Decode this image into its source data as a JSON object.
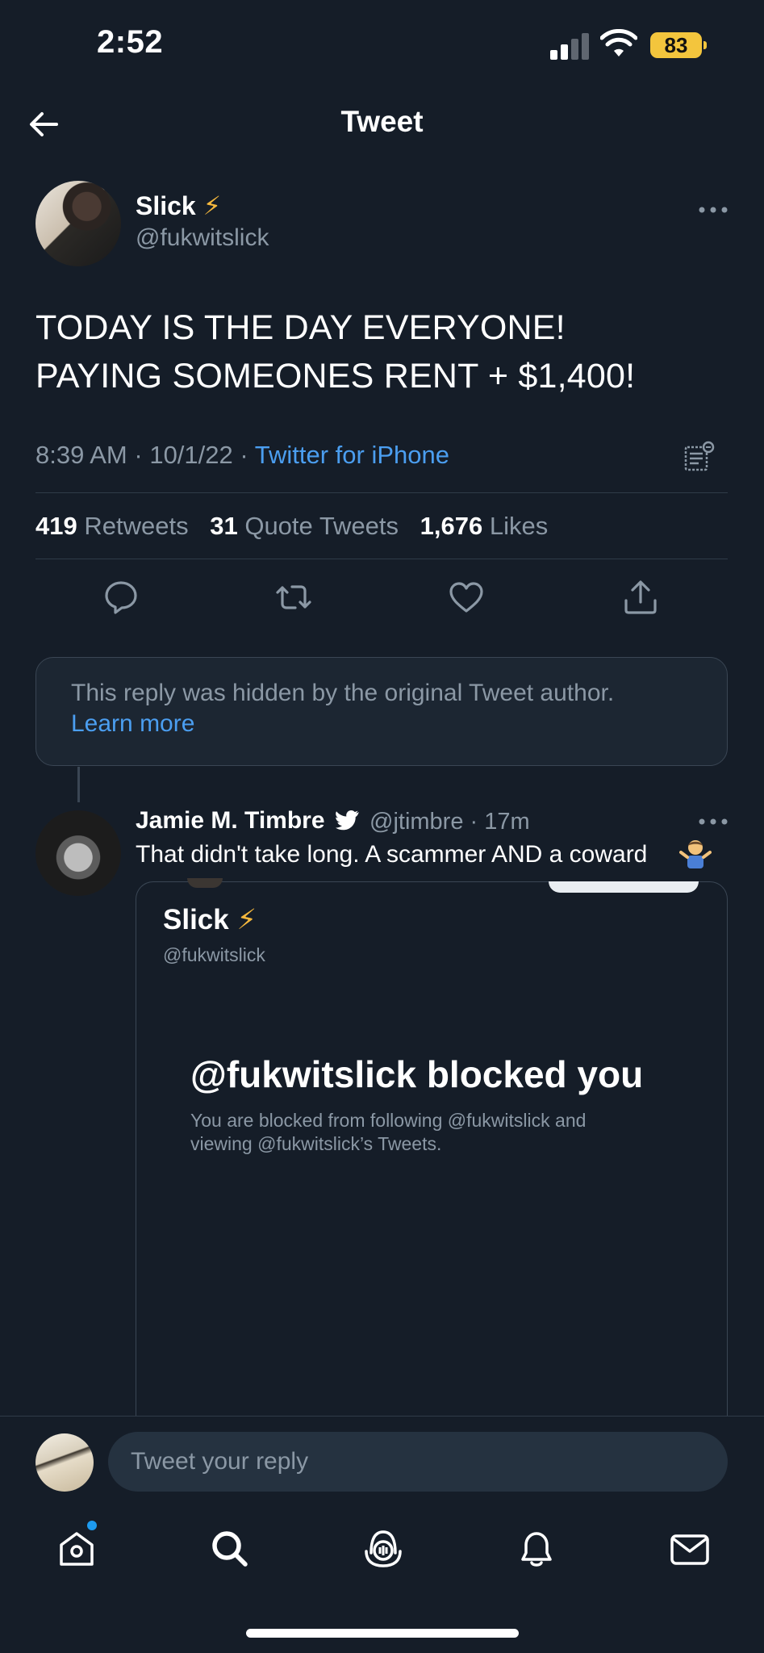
{
  "status_bar": {
    "time": "2:52",
    "battery": "83"
  },
  "header": {
    "title": "Tweet"
  },
  "tweet": {
    "author_name": "Slick",
    "author_emoji": "⚡",
    "author_handle": "@fukwitslick",
    "text_line1": "TODAY IS THE DAY EVERYONE!",
    "text_line2": "PAYING SOMEONES RENT + $1,400!",
    "time": "8:39 AM",
    "date": "10/1/22",
    "separator": "·",
    "source": "Twitter for iPhone",
    "retweets_count": "419",
    "retweets_label": "Retweets",
    "quotes_count": "31",
    "quotes_label": "Quote Tweets",
    "likes_count": "1,676",
    "likes_label": "Likes"
  },
  "hidden_reply": {
    "text": "This reply was hidden by the original Tweet author.",
    "link": "Learn more"
  },
  "reply": {
    "author_name": "Jamie M. Timbre",
    "author_handle": "@jtimbre · 17m",
    "text": "That didn't take long. A scammer AND a coward",
    "embed": {
      "name": "Slick",
      "emoji": "⚡",
      "handle": "@fukwitslick",
      "blocked_title": "@fukwitslick blocked you",
      "blocked_sub": "You are blocked from following @fukwitslick and viewing @fukwitslick’s Tweets."
    }
  },
  "compose": {
    "placeholder": "Tweet your reply"
  },
  "colors": {
    "background": "#151d28",
    "accent": "#1d9bf0",
    "link": "#4b9ef0",
    "muted": "#8b98a5"
  },
  "icons": [
    "back-arrow-icon",
    "more-icon",
    "analytics-icon",
    "reply-icon",
    "retweet-icon",
    "like-icon",
    "share-icon",
    "verified-bird-icon",
    "home-icon",
    "search-icon",
    "spaces-icon",
    "notifications-icon",
    "messages-icon"
  ]
}
